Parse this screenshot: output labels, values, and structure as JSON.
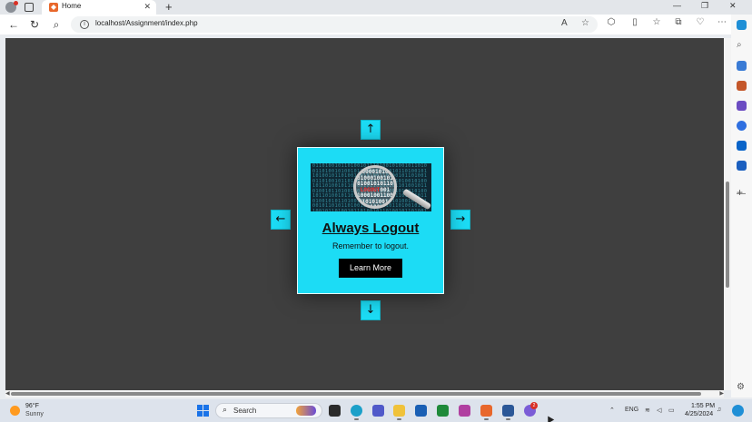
{
  "browser": {
    "tab_title": "Home",
    "url": "localhost/Assignment/index.php",
    "colors": {
      "accent": "#1cdcf5",
      "page_bg": "#3f3f3f"
    }
  },
  "card": {
    "image_alt": "binary code under magnifying glass",
    "image_word": "LOGOUT",
    "title": "Always Logout",
    "text": "Remember to logout.",
    "button_label": "Learn More"
  },
  "arrows": {
    "up": "↑",
    "down": "↓",
    "left": "←",
    "right": "→"
  },
  "taskbar": {
    "weather_temp": "96°F",
    "weather_desc": "Sunny",
    "search_label": "Search",
    "language": "ENG",
    "time": "1:55 PM",
    "date": "4/25/2024",
    "notification_count": "2"
  }
}
